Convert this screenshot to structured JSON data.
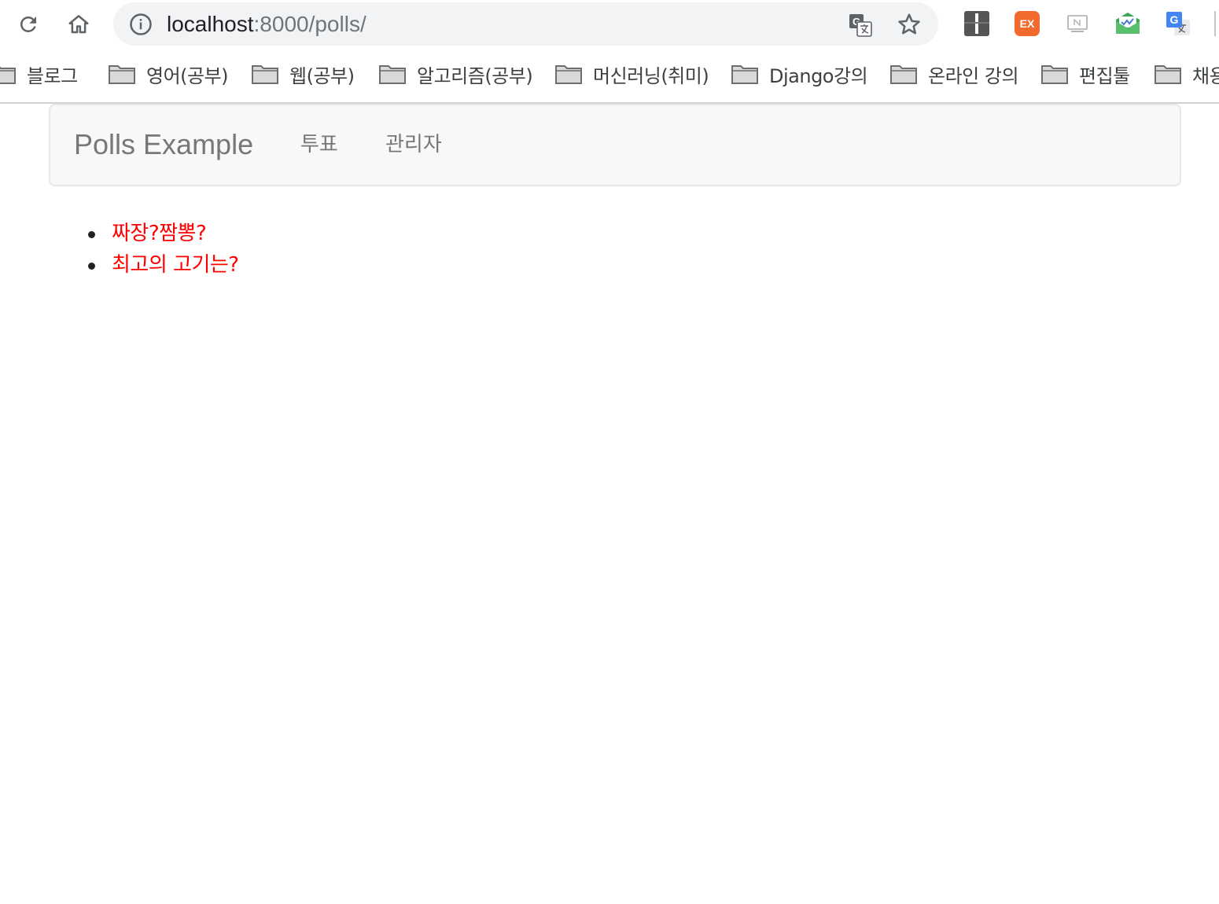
{
  "browser": {
    "url_host": "localhost",
    "url_path": ":8000/polls/",
    "icons": {
      "reload": "reload-icon",
      "home": "home-icon",
      "site_info": "info-icon",
      "translate": "translate-icon",
      "bookmark_star": "star-icon"
    },
    "extensions": [
      {
        "name": "bookmark-manager-extension",
        "text": ""
      },
      {
        "name": "ex-extension",
        "text": "EX"
      },
      {
        "name": "notion-extension",
        "text": ""
      },
      {
        "name": "mail-check-extension",
        "text": ""
      },
      {
        "name": "google-translate-extension",
        "text": "G"
      }
    ]
  },
  "bookmarks": [
    {
      "label": "블로그"
    },
    {
      "label": "영어(공부)"
    },
    {
      "label": "웹(공부)"
    },
    {
      "label": "알고리즘(공부)"
    },
    {
      "label": "머신러닝(취미)"
    },
    {
      "label": "Django강의"
    },
    {
      "label": "온라인 강의"
    },
    {
      "label": "편집툴"
    },
    {
      "label": "채용"
    }
  ],
  "navbar": {
    "brand": "Polls Example",
    "links": [
      {
        "label": "투표"
      },
      {
        "label": "관리자"
      }
    ]
  },
  "polls": [
    {
      "question": "짜장?짬뽕?"
    },
    {
      "question": "최고의 고기는?"
    }
  ],
  "colors": {
    "poll_link": "#ff0000",
    "navbar_bg": "#f8f8f8",
    "omnibox_bg": "#f1f3f4",
    "ex_extension": "#f26a2e"
  }
}
